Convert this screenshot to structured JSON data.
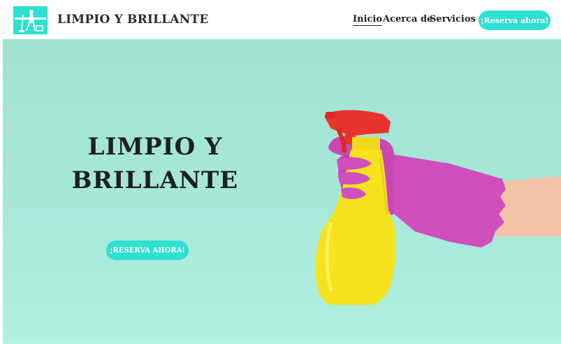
{
  "header": {
    "brand": "LIMPIO Y BRILLANTE",
    "logo_icon": "cleaning-person-logo-icon",
    "nav": [
      {
        "label": "Inicio",
        "active": true
      },
      {
        "label": "Acerca de",
        "active": false
      },
      {
        "label": "Servicios",
        "active": false
      }
    ],
    "cta_label": "¡Reserva ahora!"
  },
  "hero": {
    "title_line1": "LIMPIO Y",
    "title_line2": "BRILLANTE",
    "cta_label": "¡RESERVA AHORA!",
    "image_icon": "spray-bottle-glove-image"
  },
  "colors": {
    "accent": "#2ee0cf",
    "hero_bg": "#a6e7d8",
    "text": "#1f1f1f",
    "glove": "#d14fbd",
    "bottle": "#f4e31e",
    "nozzle": "#e8332e"
  }
}
